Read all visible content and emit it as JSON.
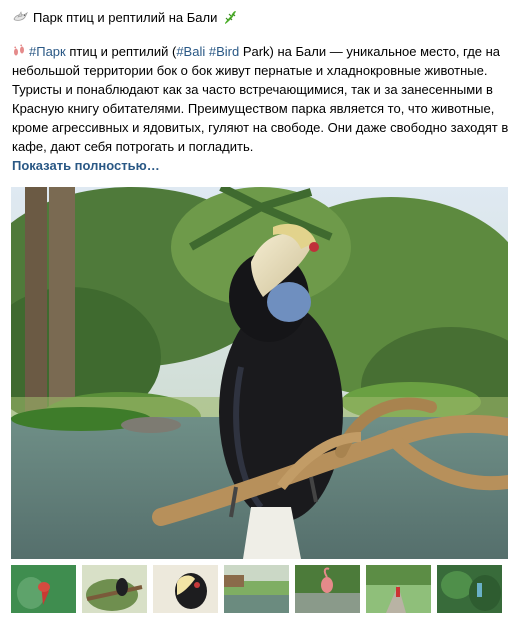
{
  "post": {
    "title": "Парк птиц и рептилий на Бали",
    "title_icon_start": "dove-icon",
    "title_icon_end": "lizard-icon",
    "text_icon": "footprints-icon",
    "tag_park": "#Парк",
    "text_1": " птиц и рептилий (",
    "tag_bali": "#Bali",
    "text_2": " ",
    "tag_bird": "#Bird",
    "text_3": " Park) на Бали — уникальное место, где на небольшой территории бок о бок живут пернатые и хладнокровные животные. Туристы и понаблюдают как за часто встречающимися, так и за занесенными в Красную книгу обитателями. Преимуществом парка является то, что животные, кроме агрессивных и ядовитых, гуляют на свободе. Они даже свободно заходят в кафе, дают себя потрогать и погладить.",
    "show_more": "Показать полностью…"
  },
  "colors": {
    "link": "#2a5885",
    "text": "#000000",
    "background": "#ffffff"
  },
  "gallery": {
    "main_photo": "hornbill-on-branch-photo",
    "thumbnails": [
      "red-bird-photo",
      "bird-on-branch-photo",
      "hornbill-closeup-photo",
      "pond-garden-photo",
      "flamingo-photo",
      "visitors-path-photo",
      "tropical-garden-photo"
    ]
  }
}
